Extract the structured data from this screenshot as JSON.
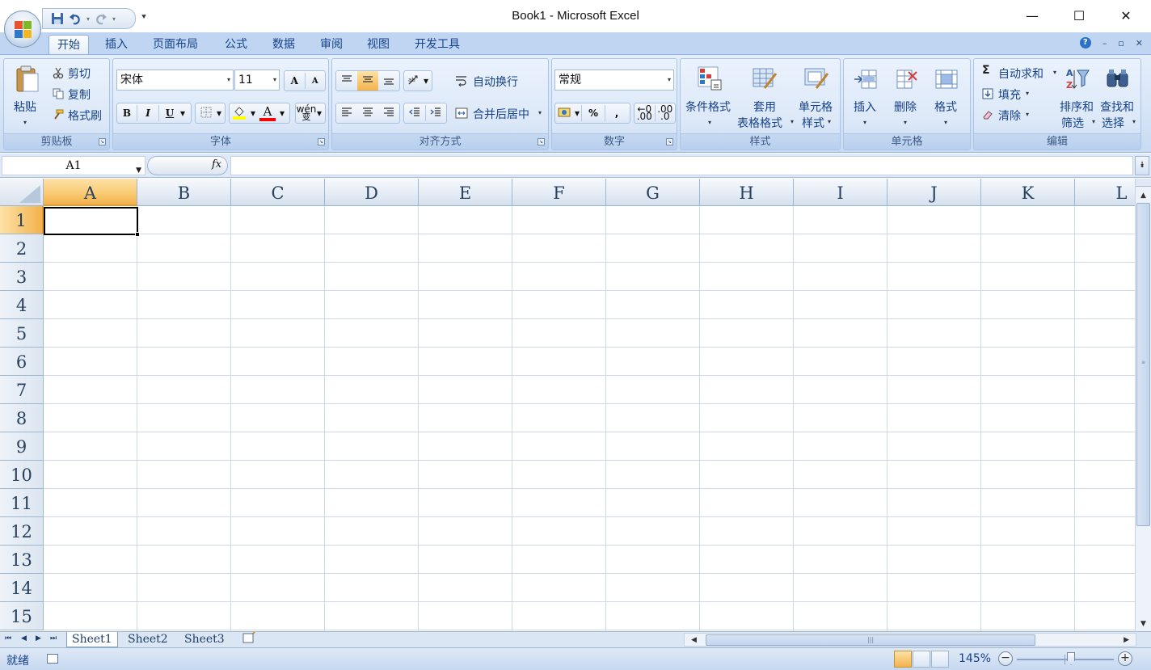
{
  "window": {
    "title": "Book1 - Microsoft Excel",
    "minimize": "—",
    "maximize": "☐",
    "close": "✕"
  },
  "qat": {
    "customize": "⯆"
  },
  "tabs": [
    {
      "label": "开始",
      "active": true
    },
    {
      "label": "插入"
    },
    {
      "label": "页面布局"
    },
    {
      "label": "公式"
    },
    {
      "label": "数据"
    },
    {
      "label": "审阅"
    },
    {
      "label": "视图"
    },
    {
      "label": "开发工具"
    }
  ],
  "tab_right": {
    "help": "?",
    "min": "–",
    "restore": "▫",
    "close": "✕"
  },
  "ribbon": {
    "clipboard": {
      "label": "剪贴板",
      "paste": "粘贴",
      "cut": "剪切",
      "copy": "复制",
      "format_painter": "格式刷"
    },
    "font": {
      "label": "字体",
      "font_name": "宋体",
      "font_size": "11",
      "grow": "A",
      "shrink": "A",
      "bold": "B",
      "italic": "I",
      "underline": "U",
      "font_color_glyph": "A",
      "phonetic": "wén"
    },
    "alignment": {
      "label": "对齐方式",
      "wrap_text": "自动换行",
      "merge_center": "合并后居中"
    },
    "number": {
      "label": "数字",
      "format": "常规",
      "percent": "%",
      "comma": ",",
      "inc_decimal": ".00",
      "dec_decimal": ".0"
    },
    "styles": {
      "label": "样式",
      "conditional": "条件格式",
      "table_format_1": "套用",
      "table_format_2": "表格格式",
      "cell_styles_1": "单元格",
      "cell_styles_2": "样式"
    },
    "cells": {
      "label": "单元格",
      "insert": "插入",
      "delete": "删除",
      "format": "格式"
    },
    "editing": {
      "label": "编辑",
      "autosum": "自动求和",
      "fill": "填充",
      "clear": "清除",
      "sort_1": "排序和",
      "sort_2": "筛选",
      "find_1": "查找和",
      "find_2": "选择"
    }
  },
  "formula_bar": {
    "name_box": "A1",
    "fx": "fx",
    "content": ""
  },
  "grid": {
    "columns": [
      "A",
      "B",
      "C",
      "D",
      "E",
      "F",
      "G",
      "H",
      "I",
      "J",
      "K",
      "L"
    ],
    "rows": [
      "1",
      "2",
      "3",
      "4",
      "5",
      "6",
      "7",
      "8",
      "9",
      "10",
      "11",
      "12",
      "13",
      "14",
      "15"
    ],
    "selected_column": "A",
    "selected_row": "1"
  },
  "sheets": [
    {
      "label": "Sheet1",
      "active": true
    },
    {
      "label": "Sheet2"
    },
    {
      "label": "Sheet3"
    }
  ],
  "status": {
    "text": "就绪",
    "zoom": "145%",
    "zoom_minus": "−",
    "zoom_plus": "+"
  },
  "colors": {
    "accent": "#15428b",
    "ribbon": "#dce8f8",
    "selected_header": "#f9c971",
    "gridline": "#d0d7e5"
  }
}
